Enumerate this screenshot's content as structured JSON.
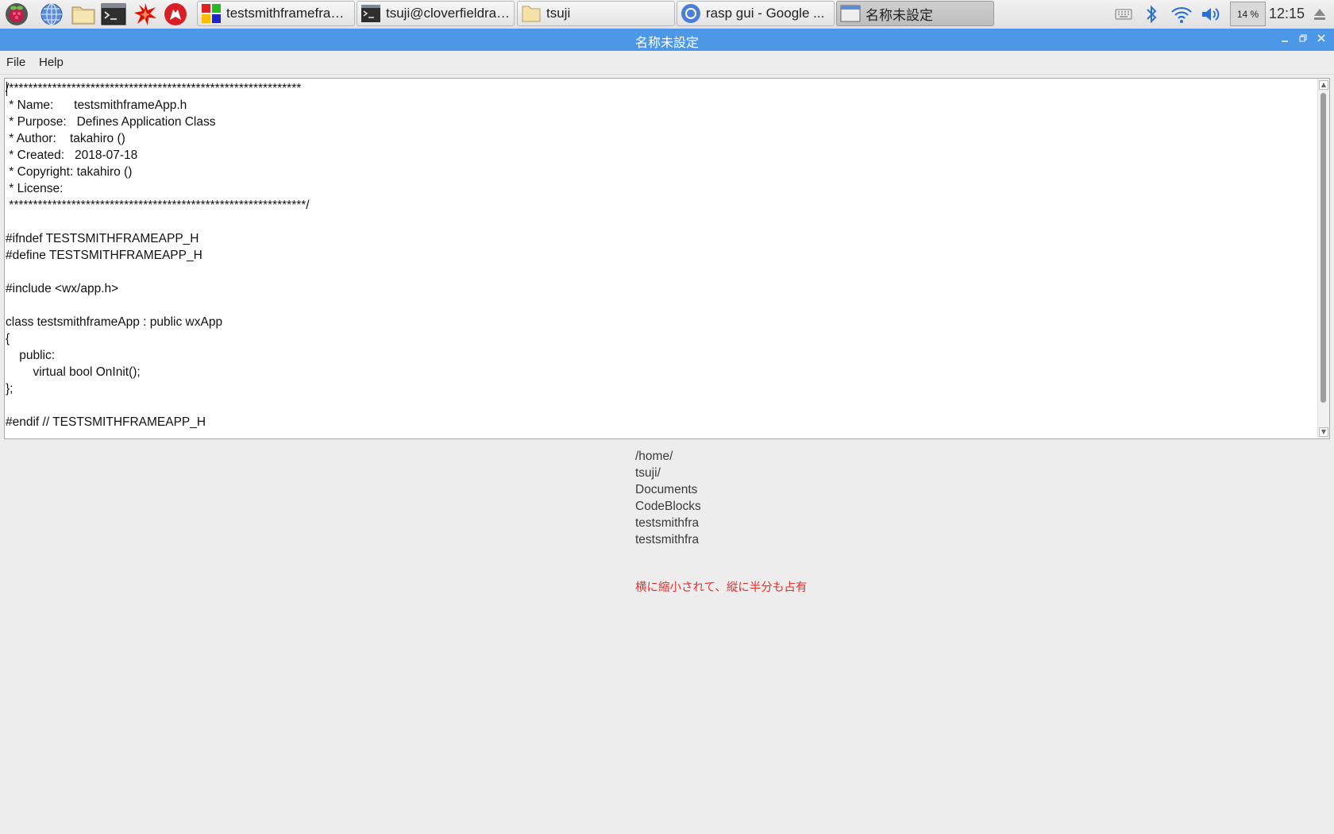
{
  "taskbar": {
    "tasks": [
      {
        "label": "testsmithframeframe..."
      },
      {
        "label": "tsuji@cloverfieldrasp..."
      },
      {
        "label": "tsuji"
      },
      {
        "label": "rasp gui - Google ..."
      },
      {
        "label": "名称未設定"
      }
    ],
    "cpu": "14 %",
    "clock": "12:15"
  },
  "window": {
    "title": "名称未設定"
  },
  "menu": {
    "file": "File",
    "help": "Help"
  },
  "editor": {
    "lines": [
      "/*************************************************************",
      " * Name:      testsmithframeApp.h",
      " * Purpose:   Defines Application Class",
      " * Author:    takahiro ()",
      " * Created:   2018-07-18",
      " * Copyright: takahiro ()",
      " * License:",
      " **************************************************************/",
      "",
      "#ifndef TESTSMITHFRAMEAPP_H",
      "#define TESTSMITHFRAMEAPP_H",
      "",
      "#include <wx/app.h>",
      "",
      "class testsmithframeApp : public wxApp",
      "{",
      "    public:",
      "        virtual bool OnInit();",
      "};",
      "",
      "#endif // TESTSMITHFRAMEAPP_H"
    ]
  },
  "path_panel": {
    "lines": [
      "/home/",
      "tsuji/",
      "Documents",
      "CodeBlocks",
      "testsmithfra",
      "testsmithfra"
    ]
  },
  "note": "横に縮小されて、縦に半分も占有",
  "colors": {
    "titlebar": "#4d98e6",
    "note": "#e03030"
  }
}
